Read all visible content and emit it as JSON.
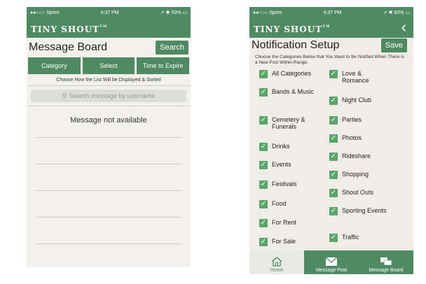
{
  "left": {
    "status": {
      "carrier": "●●○○○ Sprint",
      "time": "4:37 PM",
      "battery": "50%"
    },
    "brand": "TINY SHOUT",
    "tm": "TM",
    "title": "Message Board",
    "search_button": "Search",
    "tabs": [
      "Category",
      "Select",
      "Time to Expire"
    ],
    "hint": "Choose How the List Will be Displayed & Sorted",
    "search_placeholder": "Search message by username",
    "empty_message": "Message not available"
  },
  "right": {
    "status": {
      "carrier": "●●○○○ Sprint",
      "time": "4:37 PM",
      "battery": "50%"
    },
    "brand": "TINY SHOUT",
    "tm": "TM",
    "back_icon": "chevron-left-icon",
    "title": "Notification Setup",
    "save_button": "Save",
    "instructions": "Choose the Categories Below that You Want to Be Notified When There is a New Post Within Range.",
    "categories_left": [
      "All Categories",
      "Bands & Music",
      "Cemetery & Funerals",
      "Drinks",
      "Events",
      "Festivals",
      "Food",
      "For Rent",
      "For Sale"
    ],
    "categories_right": [
      "Love & Romance",
      "Night Club",
      "Parties",
      "Photos",
      "Rideshare",
      "Shopping",
      "Shout Outs",
      "Sporting Events",
      "Traffic"
    ],
    "nav": [
      "Home",
      "Message Post",
      "Message Board"
    ]
  },
  "colors": {
    "brand_green": "#4f8a63",
    "check_green": "#5aa66a"
  }
}
